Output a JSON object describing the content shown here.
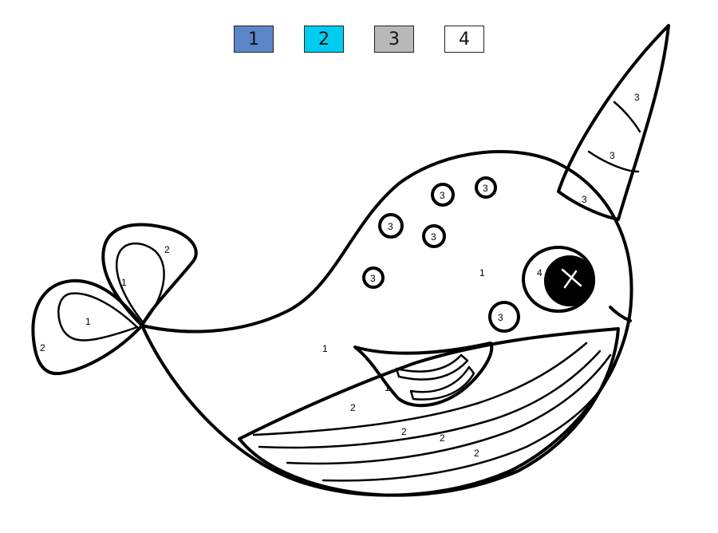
{
  "legend": [
    {
      "label": "1",
      "color": "#5b87c9"
    },
    {
      "label": "2",
      "color": "#00ccf0"
    },
    {
      "label": "3",
      "color": "#b8b8b8"
    },
    {
      "label": "4",
      "color": "#ffffff"
    }
  ],
  "regions": {
    "horn_tip": "3",
    "horn_mid": "3",
    "horn_base": "3",
    "spot_a": "3",
    "spot_b": "3",
    "spot_c": "3",
    "spot_d": "3",
    "spot_e": "3",
    "cheek": "3",
    "head": "1",
    "body": "1",
    "eye": "4",
    "fin": "1",
    "tail_upper_inner": "1",
    "tail_upper_outer": "2",
    "tail_lower_inner": "1",
    "tail_lower_outer": "2",
    "belly_1": "2",
    "belly_2": "2",
    "belly_3": "2",
    "belly_4": "2"
  }
}
